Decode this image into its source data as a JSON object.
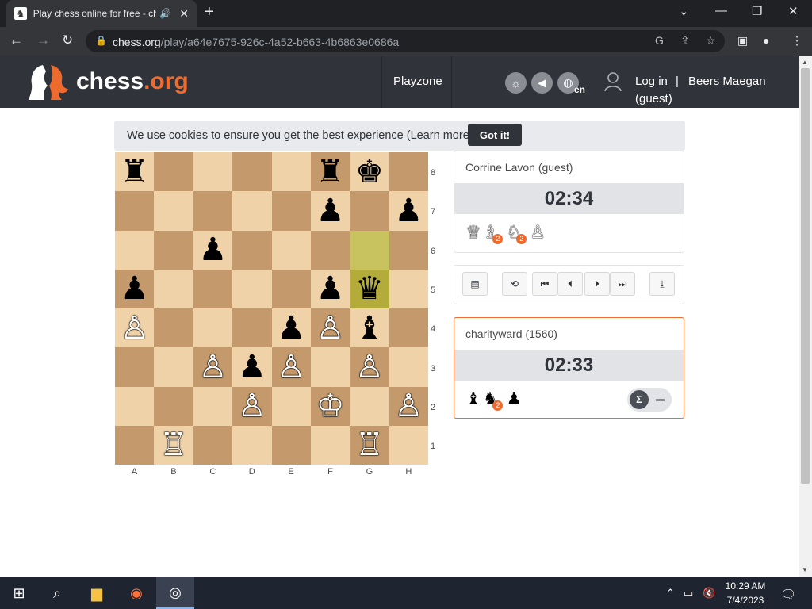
{
  "browser": {
    "tab_title": "Play chess online for free - ch",
    "tab_favicon": "chess-org-favicon",
    "new_tab": "+",
    "url_host": "chess.org",
    "url_path": "/play/a64e7675-926c-4a52-b663-4b6863e0686a",
    "icons": [
      "back-icon",
      "forward-icon",
      "reload-icon",
      "lock-icon",
      "google-icon",
      "share-icon",
      "star-icon",
      "sidepanel-icon",
      "profile-icon",
      "menu-icon"
    ]
  },
  "site": {
    "logo_main": "chess",
    "logo_accent": ".org",
    "nav_playzone": "Playzone",
    "lang": "en",
    "login": "Log in",
    "pipe": "|",
    "user_name": "Beers Maegan",
    "user_guest": "(guest)"
  },
  "cookie": {
    "text": "We use cookies to ensure you get the best experience (Learn more)",
    "button": "Got it!"
  },
  "board": {
    "ranks": [
      "8",
      "7",
      "6",
      "5",
      "4",
      "3",
      "2",
      "1"
    ],
    "files": [
      "A",
      "B",
      "C",
      "D",
      "E",
      "F",
      "G",
      "H"
    ],
    "highlight": [
      "g6",
      "g5"
    ],
    "pieces": [
      [
        {
          "g": "♜",
          "c": "b"
        },
        null,
        null,
        null,
        null,
        {
          "g": "♜",
          "c": "b"
        },
        {
          "g": "♚",
          "c": "b"
        },
        null
      ],
      [
        null,
        null,
        null,
        null,
        null,
        {
          "g": "♟",
          "c": "b"
        },
        null,
        {
          "g": "♟",
          "c": "b"
        }
      ],
      [
        null,
        null,
        {
          "g": "♟",
          "c": "b"
        },
        null,
        null,
        null,
        null,
        null
      ],
      [
        {
          "g": "♟",
          "c": "b"
        },
        null,
        null,
        null,
        null,
        {
          "g": "♟",
          "c": "b"
        },
        {
          "g": "♛",
          "c": "b"
        },
        null
      ],
      [
        {
          "g": "♙",
          "c": "w"
        },
        null,
        null,
        null,
        {
          "g": "♟",
          "c": "b"
        },
        {
          "g": "♙",
          "c": "w"
        },
        {
          "g": "♝",
          "c": "b"
        },
        null
      ],
      [
        null,
        null,
        {
          "g": "♙",
          "c": "w"
        },
        {
          "g": "♟",
          "c": "b"
        },
        {
          "g": "♙",
          "c": "w"
        },
        null,
        {
          "g": "♙",
          "c": "w"
        },
        null
      ],
      [
        null,
        null,
        null,
        {
          "g": "♙",
          "c": "w"
        },
        null,
        {
          "g": "♔",
          "c": "w"
        },
        null,
        {
          "g": "♙",
          "c": "w"
        }
      ],
      [
        null,
        {
          "g": "♖",
          "c": "w"
        },
        null,
        null,
        null,
        null,
        {
          "g": "♖",
          "c": "w"
        },
        null
      ]
    ]
  },
  "opponent": {
    "name": "Corrine Lavon (guest)",
    "clock": "02:34",
    "captured": [
      {
        "g": "♕",
        "c": "w",
        "n": null
      },
      {
        "g": "♗",
        "c": "w",
        "n": "2"
      },
      {
        "g": "♘",
        "c": "w",
        "n": "2"
      },
      {
        "g": "♙",
        "c": "w",
        "n": null
      }
    ]
  },
  "player": {
    "name": "charityward (1560)",
    "clock": "02:33",
    "captured": [
      {
        "g": "♝",
        "c": "b",
        "n": null
      },
      {
        "g": "♞",
        "c": "b",
        "n": "2"
      },
      {
        "g": "♟",
        "c": "b",
        "n": null
      }
    ],
    "toggle_symbol": "Σ"
  },
  "controls": [
    "notation-icon",
    "flip-board-icon",
    "first-move-icon",
    "prev-move-icon",
    "next-move-icon",
    "last-move-icon",
    "download-icon"
  ],
  "taskbar": {
    "time": "10:29 AM",
    "date": "7/4/2023"
  }
}
